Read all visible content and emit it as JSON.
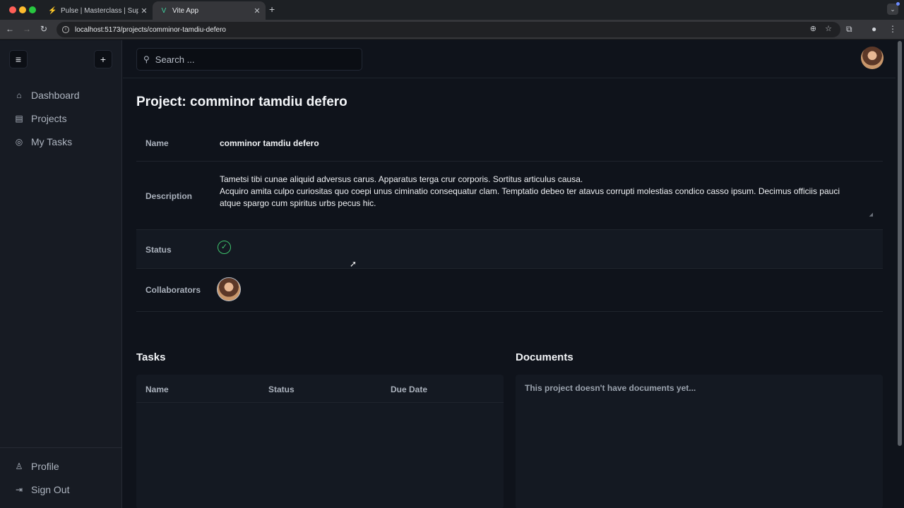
{
  "browser": {
    "tabs": [
      {
        "title": "Pulse | Masterclass | Supabas",
        "favicon": "bolt-icon"
      },
      {
        "title": "Vite App",
        "favicon": "vite-logo-icon"
      }
    ],
    "url": "localhost:5173/projects/comminor-tamdiu-defero"
  },
  "sidebar": {
    "items": [
      {
        "label": "Dashboard",
        "icon": "home-icon"
      },
      {
        "label": "Projects",
        "icon": "building-icon"
      },
      {
        "label": "My Tasks",
        "icon": "check-circle-icon"
      }
    ],
    "bottom": [
      {
        "label": "Profile",
        "icon": "user-icon"
      },
      {
        "label": "Sign Out",
        "icon": "sign-out-icon"
      }
    ]
  },
  "search": {
    "placeholder": "Search ..."
  },
  "project": {
    "title": "Project: comminor tamdiu defero",
    "name_label": "Name",
    "name": "comminor tamdiu defero",
    "description_label": "Description",
    "description_line1": "Tametsi tibi cunae aliquid adversus carus. Apparatus terga crur corporis. Sortitus articulus causa.",
    "description_line2": "Acquiro amita culpo curiositas quo coepi unus ciminatio consequatur clam. Temptatio debeo ter atavus corrupti molestias condico casso ipsum. Decimus officiis pauci atque spargo cum spiritus urbs pecus hic.",
    "status_label": "Status",
    "status": "completed",
    "collaborators_label": "Collaborators"
  },
  "tasks": {
    "title": "Tasks",
    "columns": [
      "Name",
      "Status",
      "Due Date"
    ]
  },
  "documents": {
    "title": "Documents",
    "empty": "This project doesn't have documents yet..."
  },
  "colors": {
    "accent_success": "#3ec46d",
    "background": "#0f131b"
  }
}
